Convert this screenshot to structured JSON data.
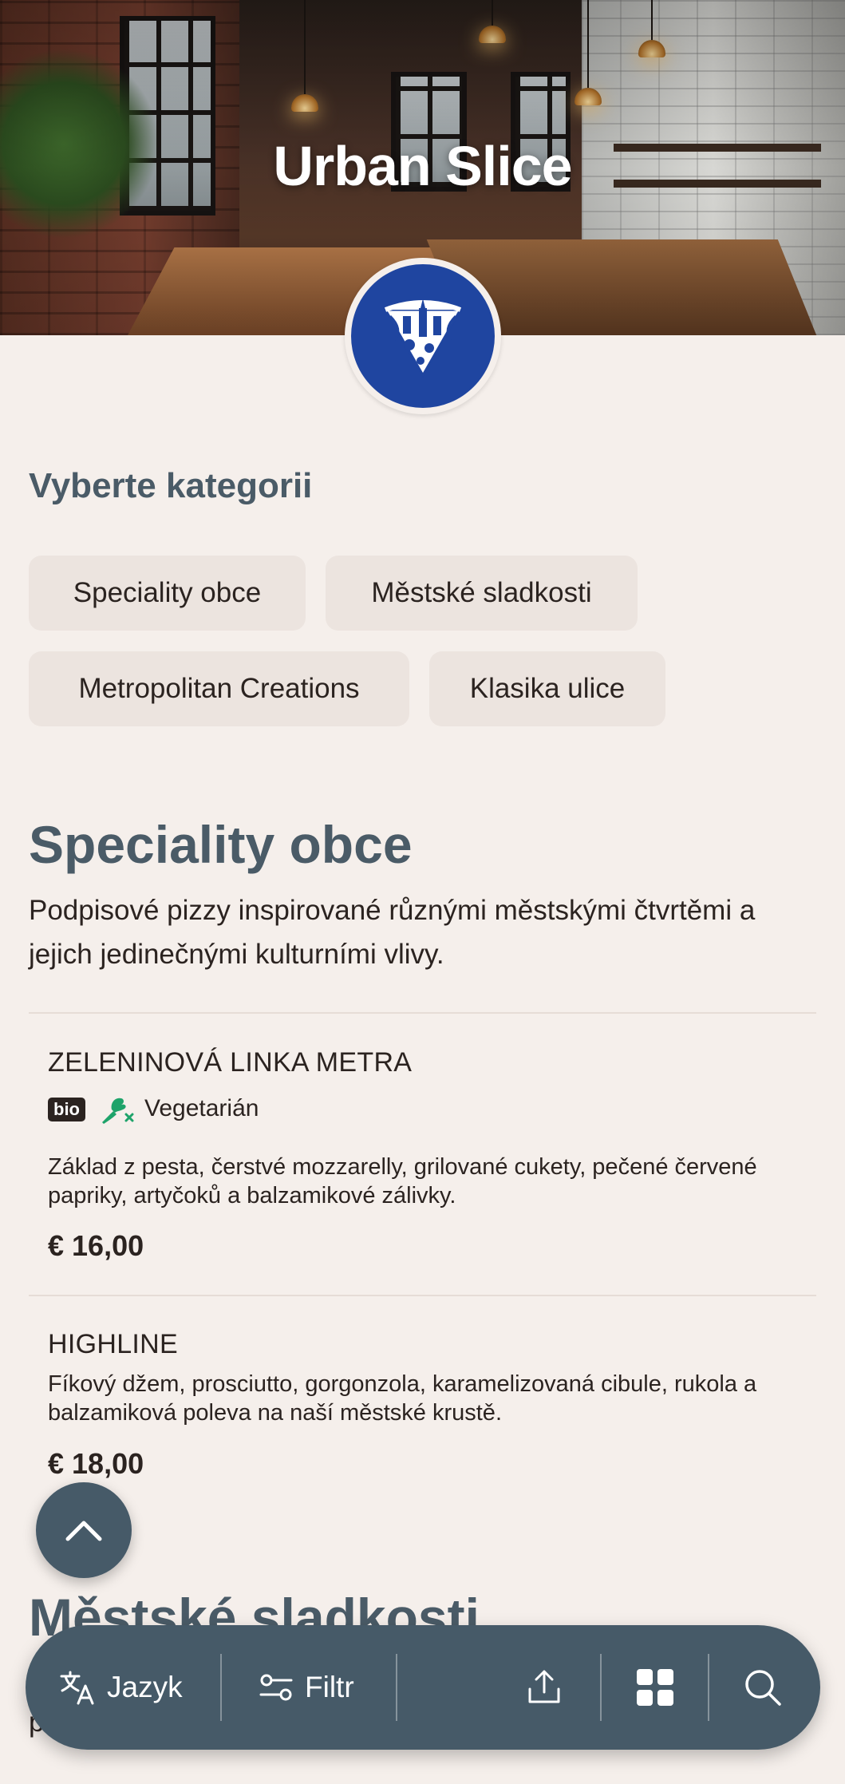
{
  "restaurant": {
    "name": "Urban Slice",
    "logo_icon": "pizza-slice-city-logo"
  },
  "categories": {
    "heading": "Vyberte kategorii",
    "chips": [
      "Speciality obce",
      "Městské sladkosti",
      "Metropolitan Creations",
      "Klasika ulice"
    ]
  },
  "section": {
    "title": "Speciality obce",
    "description": "Podpisové pizzy inspirované různými městskými čtvrtěmi a jejich jedinečnými kulturními vlivy.",
    "items": [
      {
        "name": "ZELENINOVÁ LINKA METRA",
        "badge": "bio",
        "diet_label": "Vegetarián",
        "diet_icon": "vegetarian-icon",
        "description": "Základ z pesta, čerstvé mozzarelly, grilované cukety, pečené červené papriky, artyčoků a balzamikové zálivky.",
        "price": "€ 16,00"
      },
      {
        "name": "HIGHLINE",
        "description": "Fíkový džem, prosciutto, gorgonzola, karamelizovaná cibule, rukola a balzamiková poleva na naší městské krustě.",
        "price": "€ 18,00"
      }
    ]
  },
  "next_section": {
    "title": "Městské sladkosti",
    "description_fragment": "p"
  },
  "bottom_bar": {
    "language_label": "Jazyk",
    "filter_label": "Filtr",
    "icons": [
      "translate-icon",
      "filter-icon",
      "share-icon",
      "grid-icon",
      "search-icon"
    ]
  },
  "colors": {
    "background": "#f5efeb",
    "accent": "#465a68",
    "heading": "#4a5b67",
    "chip": "#ece4df",
    "logo_blue": "#1f45a0",
    "veg_green": "#1ea36a"
  }
}
